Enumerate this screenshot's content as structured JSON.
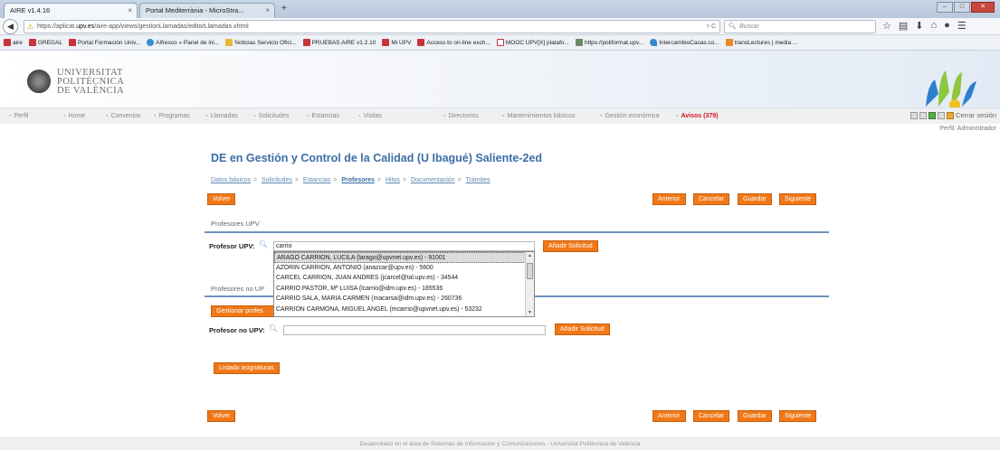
{
  "browser": {
    "tabs": [
      {
        "label": "AIRE v1.4.16",
        "close": "×"
      },
      {
        "label": "Portal Mediterrània - MicroStra...",
        "close": "×"
      }
    ],
    "new_tab": "+",
    "url_prefix": "https://aplicat.",
    "url_domain": "upv.es",
    "url_suffix": "/aire-app/views/gestionLlamadas/editorLlamadas.xhtml",
    "url_reload": "▿ C",
    "search_placeholder": "Buscar",
    "bookmarks": [
      "aire",
      "GREGAL",
      "Portal Formación Univ...",
      "Alfresco » Panel de ini...",
      "Noticias Servicio Ofici...",
      "PRUEBAS AIRE v1.2.10",
      "Mi UPV",
      "Access to on-line exch...",
      "MOOC UPV[X] platafo...",
      "https://poliformat.upv...",
      "IntercambioCasas.co...",
      "transLectures | media ..."
    ]
  },
  "site": {
    "logo_line1": "UNIVERSITAT",
    "logo_line2": "POLITÈCNICA",
    "logo_line3": "DE VALÈNCIA",
    "menu": [
      "Perfil",
      "Home",
      "Convenios",
      "Programas",
      "Llamadas",
      "Solicitudes",
      "Estancias",
      "Visitas",
      "Directorios",
      "Mantenimientos básicos",
      "Gestión económica"
    ],
    "avisos": "Avisos (379)",
    "cerrar_sesion": "Cerrar sesión",
    "perfil": "Perfil: Administrador"
  },
  "page": {
    "title": "DE en Gestión y Control de la Calidad (U Ibagué) Saliente-2ed",
    "breadcrumb": [
      {
        "label": "Datos básicos"
      },
      {
        "label": "Solicitudes"
      },
      {
        "label": "Estancias"
      },
      {
        "label": "Profesores"
      },
      {
        "label": "Hitos"
      },
      {
        "label": "Documentación"
      },
      {
        "label": "Trámites"
      }
    ],
    "breadcrumb_sep": ">",
    "buttons": {
      "volver": "Volver",
      "anterior": "Anterior",
      "cancelar": "Cancelar",
      "guardar": "Guardar",
      "siguiente": "Siguiente",
      "anadir_solicitud": "Añadir Solicitud",
      "gestionar_profesores": "Gestionar profes",
      "listado_asignaturas": "Listado asignaturas"
    },
    "section_upv": "Profesores UPV",
    "section_no_upv": "Profesores no UP",
    "label_profesor_upv": "Profesor UPV:",
    "label_profesor_no_upv": "Profesor no UPV:",
    "profesor_upv_value": "carrio",
    "profesor_no_upv_value": "",
    "dropdown_items": [
      "ARAGO CARRION, LUCILA (larago@upvnet.upv.es) - 91001",
      "AZORIN CARRION, ANTONIO (anazcar@upv.es) - 5600",
      "CARCEL CARRION, JUAN ANDRES (jcarcel@tal.upv.es) - 34544",
      "CARRIO PASTOR, Mª LUISA (lcarrio@idm.upv.es) - 185536",
      "CARRIO SALA, MARIA CARMEN (macarsa@idm.upv.es) - 260736",
      "CARRION CARMONA, MIGUEL ANGEL (mcarrio@upvnet.upv.es) - 53232"
    ]
  },
  "footer": "Desarrollado en el área de Sistemas de Información y Comunicaciones - Universitat Politècnica de València",
  "colors": {
    "accent": "#f07818",
    "title": "#3b6ea5",
    "link": "#5f87b5",
    "avisos": "#d4141a"
  }
}
